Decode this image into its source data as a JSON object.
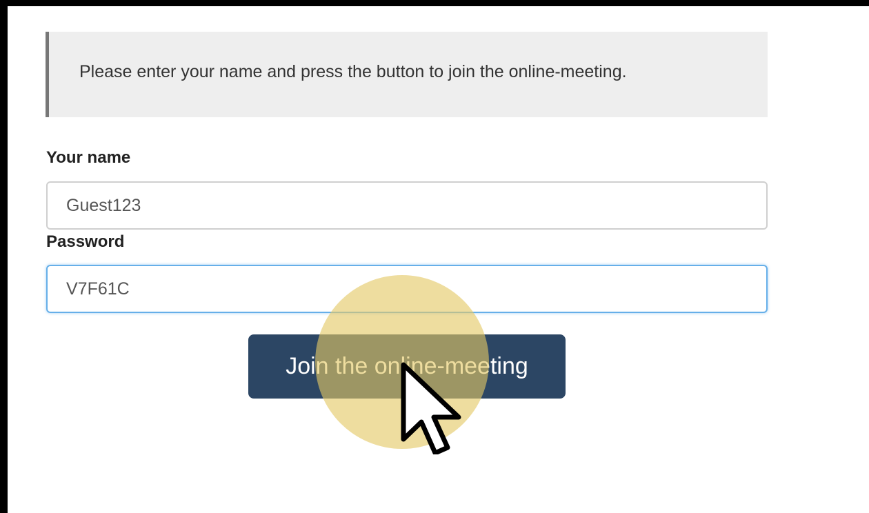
{
  "notice": {
    "text": "Please enter your name and press the button to join the online-meeting."
  },
  "form": {
    "name_label": "Your name",
    "name_value": "Guest123",
    "password_label": "Password",
    "password_value": "V7F61C"
  },
  "join_button": {
    "label": "Join the online-meeting"
  },
  "colors": {
    "button_bg": "#2c4664",
    "focus_border": "#66afe9",
    "highlight": "#e4c864"
  },
  "icons": {
    "cursor": "arrow-cursor-icon",
    "click_highlight": "click-highlight-circle"
  }
}
